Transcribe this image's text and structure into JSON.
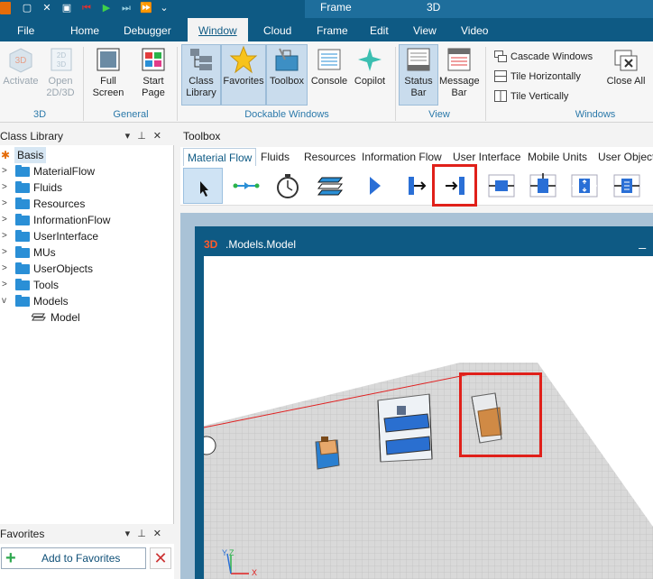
{
  "qat": {
    "icons": [
      "app-icon",
      "new-file-icon",
      "delete-icon",
      "save-icon",
      "edit-icon",
      "stop-icon",
      "play-icon",
      "step-icon",
      "fast-forward-icon",
      "more-icon"
    ]
  },
  "context": {
    "frame_label": "Frame",
    "three_d_label": "3D"
  },
  "tabs": [
    "File",
    "Home",
    "Debugger",
    "Window",
    "Cloud",
    "Frame",
    "Edit",
    "View",
    "Video"
  ],
  "active_tab": "Window",
  "ribbon": {
    "groups": [
      {
        "label": "3D",
        "buttons": [
          {
            "label": "Activate",
            "icon": "cube-3d-icon",
            "disabled": true
          },
          {
            "label": "Open 2D/3D",
            "icon": "view-2d3d-icon",
            "disabled": true
          }
        ]
      },
      {
        "label": "General",
        "buttons": [
          {
            "label": "Full Screen",
            "icon": "fullscreen-icon"
          },
          {
            "label": "Start Page",
            "icon": "start-page-icon"
          }
        ]
      },
      {
        "label": "Dockable Windows",
        "buttons": [
          {
            "label": "Class Library",
            "icon": "class-library-icon",
            "selected": true
          },
          {
            "label": "Favorites",
            "icon": "star-icon",
            "selected": true
          },
          {
            "label": "Toolbox",
            "icon": "toolbox-icon",
            "selected": true
          },
          {
            "label": "Console",
            "icon": "console-icon"
          },
          {
            "label": "Copilot",
            "icon": "copilot-icon"
          }
        ]
      },
      {
        "label": "View",
        "buttons": [
          {
            "label": "Status Bar",
            "icon": "status-bar-icon",
            "selected": true
          },
          {
            "label": "Message Bar",
            "icon": "message-bar-icon"
          }
        ]
      },
      {
        "label": "Windows",
        "buttons": [
          {
            "label": "Close All",
            "icon": "close-all-icon"
          }
        ],
        "small_buttons": [
          "Cascade Windows",
          "Tile Horizontally",
          "Tile Vertically"
        ]
      }
    ]
  },
  "class_library": {
    "title": "Class Library",
    "controls": [
      "▾",
      "⊥",
      "✕"
    ],
    "items": [
      {
        "label": "Basis",
        "level": 0,
        "expander": "",
        "selected": true
      },
      {
        "label": "MaterialFlow",
        "level": 1,
        "expander": ">"
      },
      {
        "label": "Fluids",
        "level": 1,
        "expander": ">"
      },
      {
        "label": "Resources",
        "level": 1,
        "expander": ">"
      },
      {
        "label": "InformationFlow",
        "level": 1,
        "expander": ">"
      },
      {
        "label": "UserInterface",
        "level": 1,
        "expander": ">"
      },
      {
        "label": "MUs",
        "level": 1,
        "expander": ">"
      },
      {
        "label": "UserObjects",
        "level": 1,
        "expander": ">"
      },
      {
        "label": "Tools",
        "level": 1,
        "expander": ">"
      },
      {
        "label": "Models",
        "level": 1,
        "expander": "v"
      },
      {
        "label": "Model",
        "level": 2,
        "expander": ""
      }
    ]
  },
  "favorites": {
    "title": "Favorites",
    "add_label": "Add to Favorites",
    "delete_symbol": "✕"
  },
  "toolbox": {
    "title": "Toolbox",
    "tabs": [
      "Material Flow",
      "Fluids",
      "Resources",
      "Information Flow",
      "User Interface",
      "Mobile Units",
      "User Object"
    ],
    "active_tab": "Material Flow",
    "tools": [
      "pointer-icon",
      "connector-icon",
      "event-controller-icon",
      "frame-icon",
      "source-icon",
      "drain-icon",
      "single-proc-icon",
      "parallel-proc-icon",
      "assembly-icon",
      "dismantle-icon",
      "store-icon"
    ]
  },
  "model_window": {
    "tag": "3D",
    "title": ".Models.Model",
    "minimize_symbol": "_",
    "axis_labels": [
      "Y",
      "Z",
      "X"
    ]
  },
  "colors": {
    "ribbon_blue": "#0e5a84",
    "accent": "#2b79aa",
    "highlight_red": "#e0201a"
  }
}
